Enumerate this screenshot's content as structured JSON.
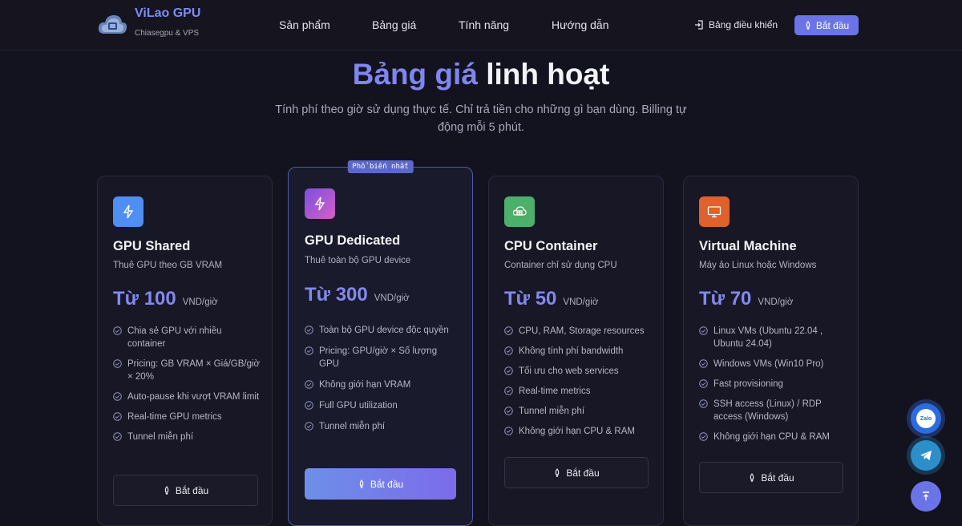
{
  "brand": {
    "name": "ViLao GPU",
    "tagline": "Chiasegpu & VPS"
  },
  "nav": {
    "items": [
      "Sản phẩm",
      "Bảng giá",
      "Tính năng",
      "Hướng dẫn"
    ],
    "dashboard": "Bảng điều khiển",
    "start": "Bắt đầu"
  },
  "hero": {
    "title_accent": "Bảng giá",
    "title_rest": "linh hoạt",
    "subtitle": "Tính phí theo giờ sử dụng thực tế. Chỉ trả tiền cho những gì bạn dùng. Billing tự động mỗi 5 phút."
  },
  "plans": [
    {
      "title": "GPU Shared",
      "desc": "Thuê GPU theo GB VRAM",
      "price": "Từ 100",
      "unit": "VND/giờ",
      "icon": "lightning-icon",
      "color": "#4f8ff3",
      "features": [
        "Chia sẻ GPU với nhiều container",
        "Pricing: GB VRAM × Giá/GB/giờ × 20%",
        "Auto-pause khi vượt VRAM limit",
        "Real-time GPU metrics",
        "Tunnel miễn phí"
      ],
      "cta": "Bắt đầu"
    },
    {
      "title": "GPU Dedicated",
      "desc": "Thuê toàn bộ GPU device",
      "price": "Từ 300",
      "unit": "VND/giờ",
      "icon": "lightning-icon",
      "color": "#b05ad6",
      "badge": "Phổ biến nhất",
      "features": [
        "Toàn bộ GPU device độc quyền",
        "Pricing: GPU/giờ × Số lượng GPU",
        "Không giới hạn VRAM",
        "Full GPU utilization",
        "Tunnel miễn phí"
      ],
      "cta": "Bắt đầu"
    },
    {
      "title": "CPU Container",
      "desc": "Container chỉ sử dụng CPU",
      "price": "Từ 50",
      "unit": "VND/giờ",
      "icon": "container-icon",
      "color": "#4caf6a",
      "features": [
        "CPU, RAM, Storage resources",
        "Không tính phí bandwidth",
        "Tối ưu cho web services",
        "Real-time metrics",
        "Tunnel miễn phí",
        "Không giới hạn CPU & RAM"
      ],
      "cta": "Bắt đầu"
    },
    {
      "title": "Virtual Machine",
      "desc": "Máy ảo Linux hoặc Windows",
      "price": "Từ 70",
      "unit": "VND/giờ",
      "icon": "monitor-icon",
      "color": "#e0602e",
      "features": [
        "Linux VMs (Ubuntu 22.04 , Ubuntu 24.04)",
        "Windows VMs (Win10 Pro)",
        "Fast provisioning",
        "SSH access (Linux) / RDP access (Windows)",
        "Không giới hạn CPU & RAM"
      ],
      "cta": "Bắt đầu"
    }
  ],
  "floating": {
    "zalo": "Zalo"
  }
}
